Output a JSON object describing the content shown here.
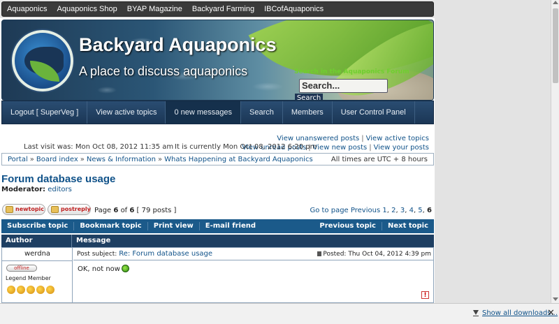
{
  "topnav": {
    "items": [
      "Aquaponics",
      "Aquaponics Shop",
      "BYAP Magazine",
      "Backyard Farming",
      "IBCofAquaponics"
    ]
  },
  "banner": {
    "title": "Backyard Aquaponics",
    "tagline": "A place to discuss aquaponics",
    "search_label": "Search in the Aquaponics Forum",
    "search_value": "Search...",
    "search_button": "Search"
  },
  "mainnav": {
    "items": [
      "Logout [ SuperVeg ]",
      "View active topics",
      "0 new messages",
      "Search",
      "Members",
      "User Control Panel"
    ]
  },
  "quicklinks": {
    "unanswered": "View unanswered posts",
    "active": "View active topics",
    "unread": "View unread posts",
    "new": "View new posts",
    "yours": "View your posts"
  },
  "info": {
    "last_visit": "Last visit was: Mon Oct 08, 2012 11:35 am",
    "currently": "It is currently Mon Oct 08, 2012 6:20 pm"
  },
  "breadcrumb": {
    "items": [
      "Portal",
      "Board index",
      "News & Information",
      "Whats Happening at Backyard Aquaponics"
    ],
    "timezone": "All times are UTC + 8 hours"
  },
  "topic": {
    "title": "Forum database usage",
    "moderator_label": "Moderator:",
    "moderator": "editors"
  },
  "buttons": {
    "new_topic": "newtopic",
    "post_reply": "postreply"
  },
  "pageinfo": {
    "prefix": "Page",
    "current": "6",
    "of": "of",
    "total": "6",
    "posts": "[ 79 posts ]"
  },
  "pagination": {
    "label": "Go to page",
    "previous": "Previous",
    "pages": [
      "1",
      "2",
      "3",
      "4",
      "5"
    ],
    "current": "6"
  },
  "actionbar": {
    "left": [
      "Subscribe topic",
      "Bookmark topic",
      "Print view",
      "E-mail friend"
    ],
    "right": [
      "Previous topic",
      "Next topic"
    ]
  },
  "table": {
    "author_header": "Author",
    "message_header": "Message"
  },
  "post": {
    "author": "werdna",
    "status": "offline",
    "rank": "Legend Member",
    "stars": 5,
    "subject_label": "Post subject:",
    "subject": "Re: Forum database usage",
    "posted": "Posted: Thu Oct 04, 2012 4:39 pm",
    "body": "OK, not now",
    "report_icon": "!"
  },
  "downloads": {
    "show_all": "Show all downloads...",
    "close": "✕"
  },
  "colors": {
    "nav_bg": "#1b3655",
    "link": "#105289",
    "action_bar": "#1b5a8a",
    "table_head": "#1e3f62"
  }
}
